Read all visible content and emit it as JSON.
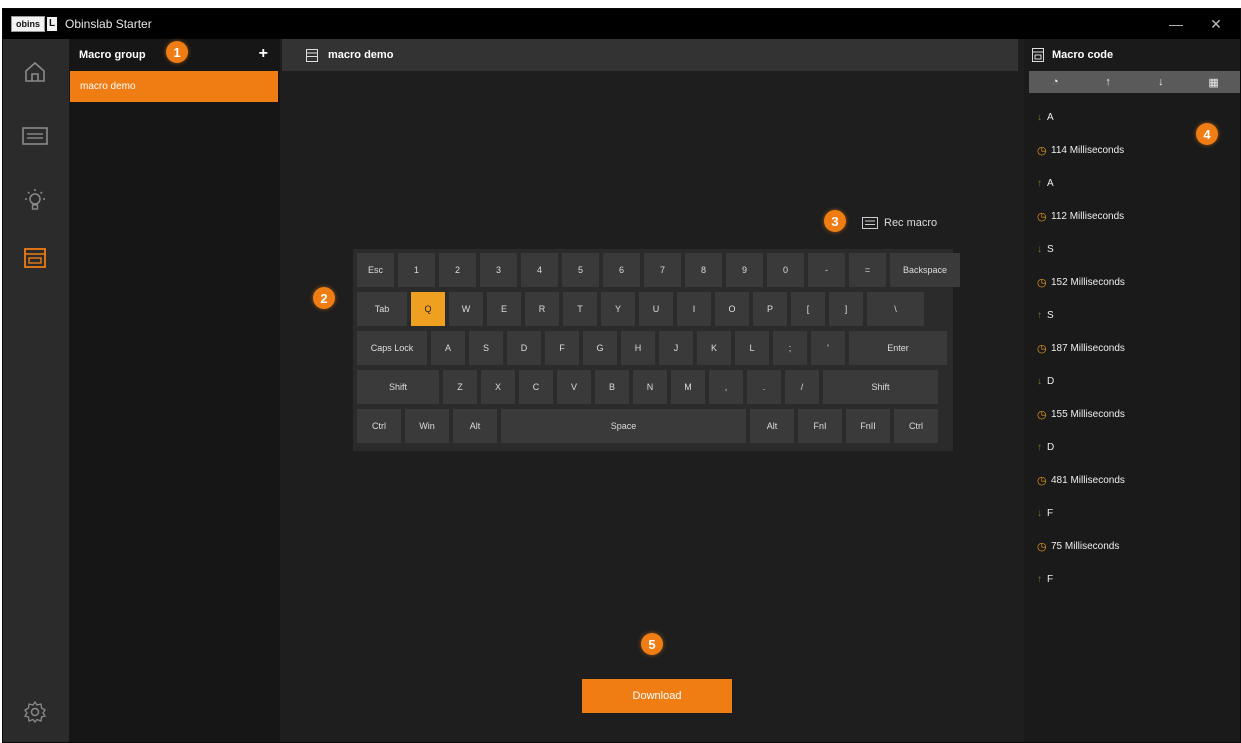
{
  "window": {
    "logo_text": "obins",
    "logo_mark": "L",
    "title": "Obinslab Starter",
    "minimize": "—",
    "close": "✕"
  },
  "sidebar": {
    "icons": [
      "home-icon",
      "keyboard-icon",
      "light-bulb-icon",
      "macro-icon",
      "settings-gear-icon"
    ]
  },
  "macro_group": {
    "title": "Macro group",
    "add": "+",
    "items": [
      "macro demo"
    ]
  },
  "editor": {
    "title": "macro demo",
    "rec_label": "Rec macro",
    "download_label": "Download"
  },
  "keyboard": {
    "rows": [
      [
        "Esc",
        "1",
        "2",
        "3",
        "4",
        "5",
        "6",
        "7",
        "8",
        "9",
        "0",
        "-",
        "=",
        "Backspace"
      ],
      [
        "Tab",
        "Q",
        "W",
        "E",
        "R",
        "T",
        "Y",
        "U",
        "I",
        "O",
        "P",
        "[",
        "]",
        "\\"
      ],
      [
        "Caps Lock",
        "A",
        "S",
        "D",
        "F",
        "G",
        "H",
        "J",
        "K",
        "L",
        ";",
        "'",
        "Enter"
      ],
      [
        "Shift",
        "Z",
        "X",
        "C",
        "V",
        "B",
        "N",
        "M",
        ",",
        ".",
        "/",
        "Shift"
      ],
      [
        "Ctrl",
        "Win",
        "Alt",
        "Space",
        "Alt",
        "FnI",
        "FnII",
        "Ctrl"
      ]
    ],
    "active_key": "Q"
  },
  "macro_code": {
    "title": "Macro code",
    "toolbar": [
      "clock-icon",
      "up-icon",
      "down-icon",
      "delete-icon"
    ],
    "entries": [
      {
        "kind": "down",
        "text": "A"
      },
      {
        "kind": "delay",
        "text": "114 Milliseconds"
      },
      {
        "kind": "up",
        "text": "A"
      },
      {
        "kind": "delay",
        "text": "112 Milliseconds"
      },
      {
        "kind": "down",
        "text": "S"
      },
      {
        "kind": "delay",
        "text": "152 Milliseconds"
      },
      {
        "kind": "up",
        "text": "S"
      },
      {
        "kind": "delay",
        "text": "187 Milliseconds"
      },
      {
        "kind": "down",
        "text": "D"
      },
      {
        "kind": "delay",
        "text": "155 Milliseconds"
      },
      {
        "kind": "up",
        "text": "D"
      },
      {
        "kind": "delay",
        "text": "481 Milliseconds"
      },
      {
        "kind": "down",
        "text": "F"
      },
      {
        "kind": "delay",
        "text": "75 Milliseconds"
      },
      {
        "kind": "up",
        "text": "F"
      }
    ]
  },
  "badges": [
    "1",
    "2",
    "3",
    "4",
    "5"
  ],
  "colors": {
    "accent": "#ef7d14",
    "active_key": "#f0a020",
    "background": "#1e1e1e"
  }
}
